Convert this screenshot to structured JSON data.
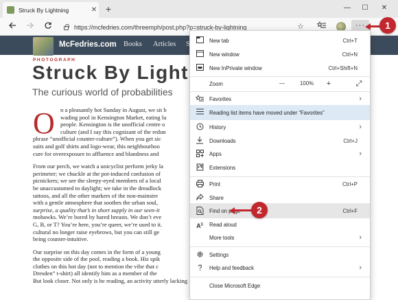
{
  "tab": {
    "title": "Struck By Lightning",
    "close": "✕",
    "new_tab": "+"
  },
  "window": {
    "minimize": "—",
    "maximize": "☐",
    "close": "✕"
  },
  "address": {
    "url": "https://mcfedries.com/threemph/post.php?p=struck-by-lightning"
  },
  "toolbar": {
    "favorites_star": "☆",
    "reading_list": "★",
    "more": "···"
  },
  "site": {
    "name": "McFedries.com",
    "nav": [
      "Books",
      "Articles",
      "S"
    ]
  },
  "article": {
    "kicker": "PHOTOGRAPH",
    "headline": "Struck By Lightning",
    "subtitle": "The curious world of probabilities",
    "dropcap": "O",
    "p1": [
      "n a pleasantly hot Sunday in August, we sit b",
      "wading pool in Kensington Market, eating lu",
      "people. Kensington is the unofficial centre o",
      "culture (and I say this cognizant of the redun",
      "phrase “unofficial counter-culture”). When you get sic",
      "suits and golf shirts and logo-wear, this neighbourhoo",
      "cure for overexposure to affluence and blandness and"
    ],
    "p2": [
      "From our perch, we watch a unicyclist perform jerky la",
      "perimeter; we chuckle at the pot-induced confusion of",
      "picnickers; we see the sleepy-eyed members of a local",
      "be unaccustomed to daylight; we take in the dreadlock",
      "tattoos, and all the other markers of the non-mainstre",
      "with a gentle atmosphere that soothes the urban soul,",
      "surprise, a quality that’s in short supply in our seen-it",
      "mohawks. We’re bored by bared breasts. We don’t eve",
      "G, B, or T? You’re here, you’re queer, we’re used to it.",
      "cultural no longer raise eyebrows, but you can still ge",
      "being counter-intuitive."
    ],
    "p3": [
      "Our surprise on this day comes in the form of a young",
      "the opposite side of the pool, reading a book. His spik",
      "clothes on this hot day (not to mention the vibe that c",
      "Dresden” t-shirt) all identify him as a member of the",
      "But look closer. Not only is he reading, an activity utterly lacking in cool in"
    ]
  },
  "menu": {
    "items": [
      {
        "label": "New tab",
        "shortcut": "Ctrl+T"
      },
      {
        "label": "New window",
        "shortcut": "Ctrl+N"
      },
      {
        "label": "New InPrivate window",
        "shortcut": "Ctrl+Shift+N"
      },
      {
        "label": "Zoom",
        "value": "100%",
        "minus": "—",
        "plus": "+",
        "fullscreen": "⤢"
      },
      {
        "label": "Favorites"
      },
      {
        "label": "Reading list items have moved under “Favorites”"
      },
      {
        "label": "History"
      },
      {
        "label": "Downloads",
        "shortcut": "Ctrl+J"
      },
      {
        "label": "Apps"
      },
      {
        "label": "Extensions"
      },
      {
        "label": "Print",
        "shortcut": "Ctrl+P"
      },
      {
        "label": "Share"
      },
      {
        "label": "Find on page",
        "shortcut": "Ctrl+F"
      },
      {
        "label": "Read aloud"
      },
      {
        "label": "More tools"
      },
      {
        "label": "Settings"
      },
      {
        "label": "Help and feedback"
      },
      {
        "label": "Close Microsoft Edge"
      }
    ]
  },
  "callouts": {
    "one": "1",
    "two": "2"
  },
  "colors": {
    "callout": "#c1272d",
    "site_header": "#3c4b5b",
    "highlight": "#dde9f5",
    "kicker": "#b22a2a"
  }
}
